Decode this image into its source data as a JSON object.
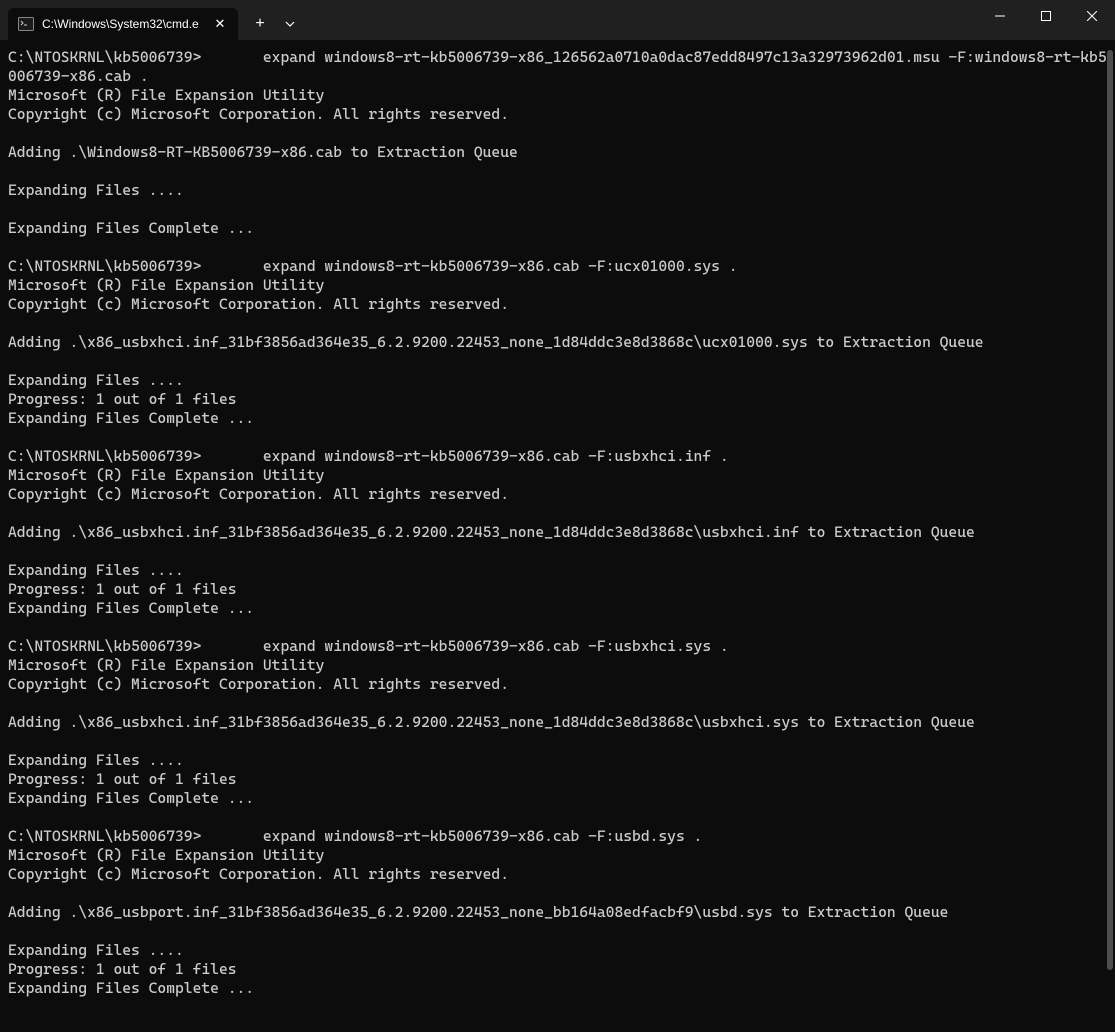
{
  "titlebar": {
    "tab_title": "C:\\Windows\\System32\\cmd.e",
    "tab_close": "✕",
    "new_tab": "+"
  },
  "terminal": {
    "lines": [
      "C:\\NTOSKRNL\\kb5006739>       expand windows8-rt-kb5006739-x86_126562a0710a0dac87edd8497c13a32973962d01.msu -F:windows8-rt-kb5006739-x86.cab .",
      "Microsoft (R) File Expansion Utility",
      "Copyright (c) Microsoft Corporation. All rights reserved.",
      "",
      "Adding .\\Windows8-RT-KB5006739-x86.cab to Extraction Queue",
      "",
      "Expanding Files ....",
      "",
      "Expanding Files Complete ...",
      "",
      "C:\\NTOSKRNL\\kb5006739>       expand windows8-rt-kb5006739-x86.cab -F:ucx01000.sys .",
      "Microsoft (R) File Expansion Utility",
      "Copyright (c) Microsoft Corporation. All rights reserved.",
      "",
      "Adding .\\x86_usbxhci.inf_31bf3856ad364e35_6.2.9200.22453_none_1d84ddc3e8d3868c\\ucx01000.sys to Extraction Queue",
      "",
      "Expanding Files ....",
      "Progress: 1 out of 1 files",
      "Expanding Files Complete ...",
      "",
      "C:\\NTOSKRNL\\kb5006739>       expand windows8-rt-kb5006739-x86.cab -F:usbxhci.inf .",
      "Microsoft (R) File Expansion Utility",
      "Copyright (c) Microsoft Corporation. All rights reserved.",
      "",
      "Adding .\\x86_usbxhci.inf_31bf3856ad364e35_6.2.9200.22453_none_1d84ddc3e8d3868c\\usbxhci.inf to Extraction Queue",
      "",
      "Expanding Files ....",
      "Progress: 1 out of 1 files",
      "Expanding Files Complete ...",
      "",
      "C:\\NTOSKRNL\\kb5006739>       expand windows8-rt-kb5006739-x86.cab -F:usbxhci.sys .",
      "Microsoft (R) File Expansion Utility",
      "Copyright (c) Microsoft Corporation. All rights reserved.",
      "",
      "Adding .\\x86_usbxhci.inf_31bf3856ad364e35_6.2.9200.22453_none_1d84ddc3e8d3868c\\usbxhci.sys to Extraction Queue",
      "",
      "Expanding Files ....",
      "Progress: 1 out of 1 files",
      "Expanding Files Complete ...",
      "",
      "C:\\NTOSKRNL\\kb5006739>       expand windows8-rt-kb5006739-x86.cab -F:usbd.sys .",
      "Microsoft (R) File Expansion Utility",
      "Copyright (c) Microsoft Corporation. All rights reserved.",
      "",
      "Adding .\\x86_usbport.inf_31bf3856ad364e35_6.2.9200.22453_none_bb164a08edfacbf9\\usbd.sys to Extraction Queue",
      "",
      "Expanding Files ....",
      "Progress: 1 out of 1 files",
      "Expanding Files Complete ..."
    ]
  }
}
